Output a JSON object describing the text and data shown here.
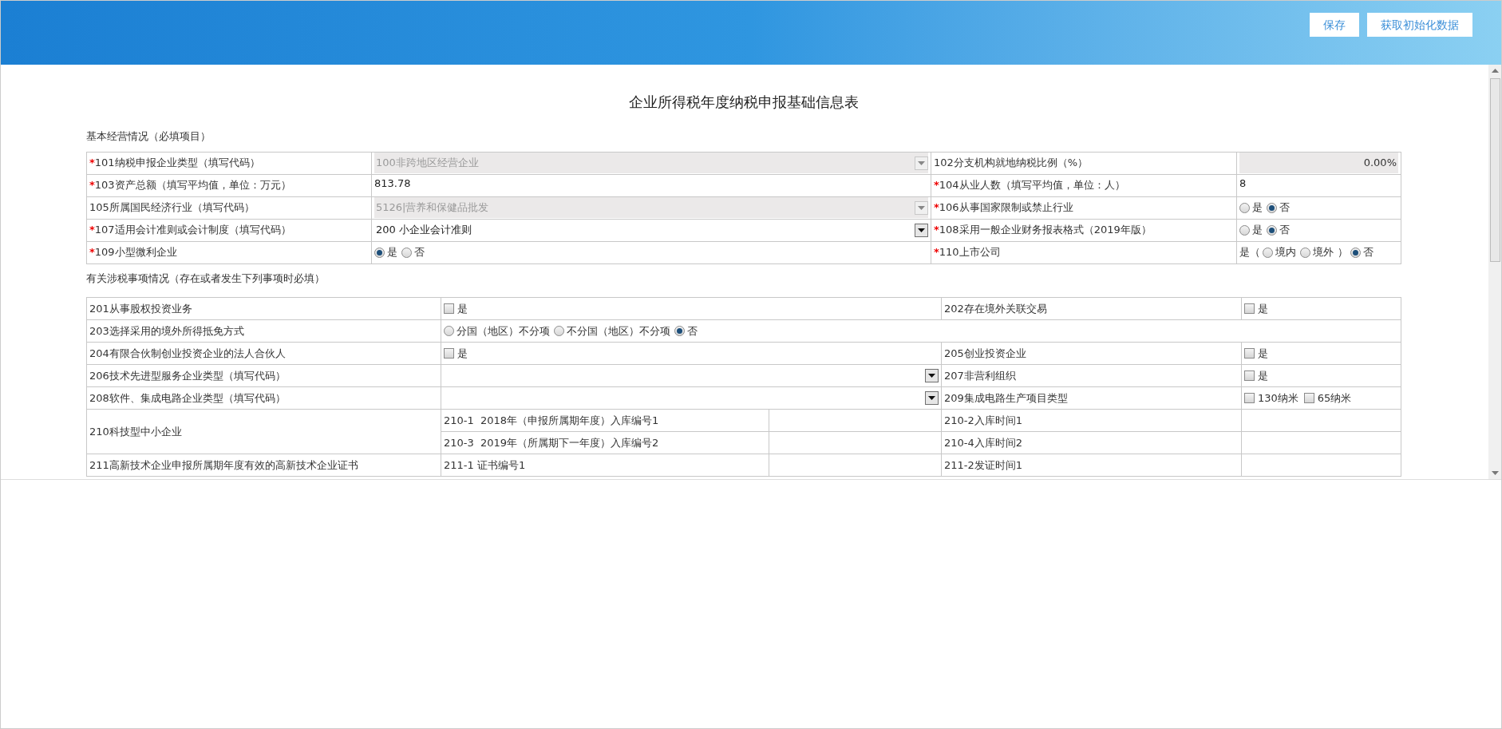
{
  "header": {
    "buttons": [
      {
        "label": "保存"
      },
      {
        "label": "获取初始化数据"
      }
    ]
  },
  "title": "企业所得税年度纳税申报基础信息表",
  "basic": {
    "heading": "基本经营情况（必填项目）",
    "items": [
      {
        "label": "101纳税申报企业类型（填写代码）",
        "required_mark": "*",
        "field": {
          "kind": "select",
          "value": "100非跨地区经营企业",
          "disabled": true
        }
      },
      {
        "label": "102分支机构就地纳税比例（%）",
        "field": {
          "kind": "number",
          "value": "0.00%",
          "disabled": true
        }
      },
      {
        "label": "103资产总额（填写平均值，单位：万元）",
        "required_mark": "*",
        "field": {
          "kind": "text",
          "value": "813.78"
        }
      },
      {
        "label": "104从业人数（填写平均值，单位：人）",
        "required_mark": "*",
        "field": {
          "kind": "text",
          "value": "8"
        }
      },
      {
        "label": "105所属国民经济行业（填写代码）",
        "field": {
          "kind": "select",
          "value": "5126|营养和保健品批发",
          "disabled": true
        }
      },
      {
        "label": "106从事国家限制或禁止行业",
        "required_mark": "*",
        "field": {
          "kind": "choices",
          "options": [
            {
              "kind": "radio",
              "label": "是",
              "selected": false
            },
            {
              "kind": "radio",
              "label": "否",
              "selected": true
            }
          ]
        }
      },
      {
        "label": "107适用会计准则或会计制度（填写代码）",
        "required_mark": "*",
        "field": {
          "kind": "select",
          "value": "200 小企业会计准则",
          "disabled": false
        }
      },
      {
        "label": "108采用一般企业财务报表格式（2019年版）",
        "required_mark": "*",
        "field": {
          "kind": "choices",
          "options": [
            {
              "kind": "radio",
              "label": "是",
              "selected": false
            },
            {
              "kind": "radio",
              "label": "否",
              "selected": true
            }
          ]
        }
      },
      {
        "label": "109小型微利企业",
        "required_mark": "*",
        "field": {
          "kind": "choices",
          "options": [
            {
              "kind": "radio",
              "label": "是",
              "selected": true
            },
            {
              "kind": "radio",
              "label": "否",
              "selected": false
            }
          ]
        }
      },
      {
        "label": "110上市公司",
        "required_mark": "*",
        "field": {
          "kind": "choices",
          "options": [
            {
              "kind": "text",
              "label": "是（"
            },
            {
              "kind": "radio",
              "label": "境内",
              "selected": false
            },
            {
              "kind": "radio",
              "label": "境外",
              "selected": false
            },
            {
              "kind": "text",
              "label": "）"
            },
            {
              "kind": "radio",
              "label": "否",
              "selected": true
            }
          ]
        }
      }
    ]
  },
  "tax": {
    "heading": "有关涉税事项情况（存在或者发生下列事项时必填）",
    "rows": [
      {
        "kind": "pair",
        "items": [
          {
            "label": "201从事股权投资业务",
            "field": {
              "kind": "choices",
              "options": [
                {
                  "kind": "checkbox",
                  "label": "是",
                  "checked": false
                }
              ]
            }
          },
          {
            "label": "202存在境外关联交易",
            "field": {
              "kind": "choices",
              "options": [
                {
                  "kind": "checkbox",
                  "label": "是",
                  "checked": false
                }
              ]
            }
          }
        ]
      },
      {
        "kind": "wide",
        "label": "203选择采用的境外所得抵免方式",
        "field": {
          "kind": "choices",
          "options": [
            {
              "kind": "radio",
              "label": "分国（地区）不分项",
              "selected": false
            },
            {
              "kind": "radio",
              "label": "不分国（地区）不分项",
              "selected": false
            },
            {
              "kind": "radio",
              "label": "否",
              "selected": true
            }
          ]
        }
      },
      {
        "kind": "pair",
        "items": [
          {
            "label": "204有限合伙制创业投资企业的法人合伙人",
            "field": {
              "kind": "choices",
              "options": [
                {
                  "kind": "checkbox",
                  "label": "是",
                  "checked": false
                }
              ]
            }
          },
          {
            "label": "205创业投资企业",
            "field": {
              "kind": "choices",
              "options": [
                {
                  "kind": "checkbox",
                  "label": "是",
                  "checked": false
                }
              ]
            }
          }
        ]
      },
      {
        "kind": "pair",
        "items": [
          {
            "label": "206技术先进型服务企业类型（填写代码）",
            "field": {
              "kind": "select",
              "disabled": false
            }
          },
          {
            "label": "207非营利组织",
            "field": {
              "kind": "choices",
              "options": [
                {
                  "kind": "checkbox",
                  "label": "是",
                  "checked": false
                }
              ]
            }
          }
        ]
      },
      {
        "kind": "pair",
        "items": [
          {
            "label": "208软件、集成电路企业类型（填写代码）",
            "field": {
              "kind": "select",
              "disabled": false
            }
          },
          {
            "label": "209集成电路生产项目类型",
            "field": {
              "kind": "choices",
              "options": [
                {
                  "kind": "checkbox",
                  "label": "130纳米",
                  "checked": false
                },
                {
                  "kind": "checkbox",
                  "label": "65纳米",
                  "checked": false
                }
              ]
            }
          }
        ]
      },
      {
        "kind": "group",
        "label": "210科技型中小企业",
        "subrows": [
          {
            "items": [
              {
                "label": "210-1  2018年（申报所属期年度）入库编号1"
              },
              {
                "label": "210-2入库时间1"
              }
            ]
          },
          {
            "items": [
              {
                "label": "210-3  2019年（所属期下一年度）入库编号2"
              },
              {
                "label": "210-4入库时间2"
              }
            ]
          }
        ]
      },
      {
        "kind": "group",
        "label": "211高新技术企业申报所属期年度有效的高新技术企业证书",
        "subrows": [
          {
            "items": [
              {
                "label": "211-1 证书编号1"
              },
              {
                "label": "211-2发证时间1"
              }
            ]
          }
        ]
      }
    ]
  }
}
